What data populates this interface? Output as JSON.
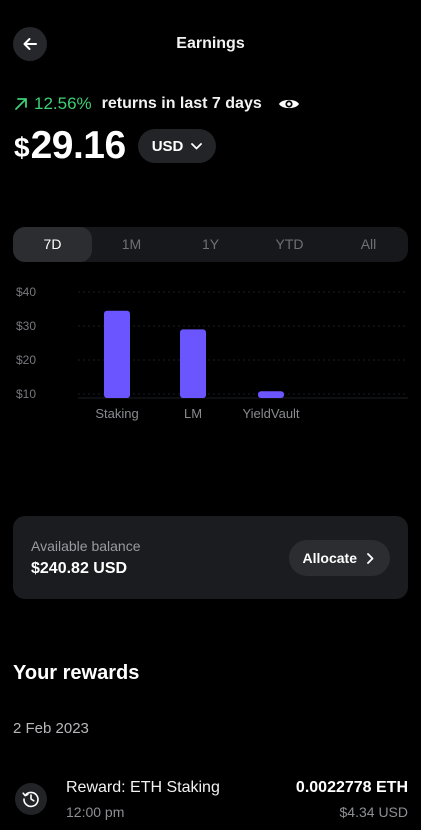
{
  "header": {
    "title": "Earnings",
    "back_icon": "arrow-left-icon"
  },
  "returns": {
    "percent": "12.56%",
    "text": "returns in last 7 days",
    "trend_icon": "arrow-up-right-icon",
    "visibility_icon": "eye-icon",
    "color": "#3ccf73"
  },
  "balance": {
    "symbol": "$",
    "amount": "29.16",
    "currency": "USD",
    "dropdown_icon": "chevron-down-icon"
  },
  "tabs": [
    {
      "label": "7D",
      "active": true
    },
    {
      "label": "1M",
      "active": false
    },
    {
      "label": "1Y",
      "active": false
    },
    {
      "label": "YTD",
      "active": false
    },
    {
      "label": "All",
      "active": false
    }
  ],
  "chart_data": {
    "type": "bar",
    "categories": [
      "Staking",
      "LM",
      "YieldVault"
    ],
    "values": [
      34.5,
      29,
      10.8
    ],
    "y_ticks": [
      "$40",
      "$30",
      "$20",
      "$10"
    ],
    "y_tick_values": [
      40,
      30,
      20,
      10
    ],
    "ylim": [
      10,
      40
    ],
    "bar_color": "#6b55ff",
    "grid": true
  },
  "available_balance": {
    "label": "Available balance",
    "value": "$240.82 USD",
    "button_label": "Allocate",
    "button_icon": "chevron-right-icon"
  },
  "rewards": {
    "title": "Your rewards",
    "date": "2 Feb 2023",
    "items": [
      {
        "title": "Reward: ETH Staking",
        "time": "12:00 pm",
        "amount": "0.0022778 ETH",
        "usd": "$4.34 USD",
        "icon": "history-clock-icon"
      }
    ]
  }
}
